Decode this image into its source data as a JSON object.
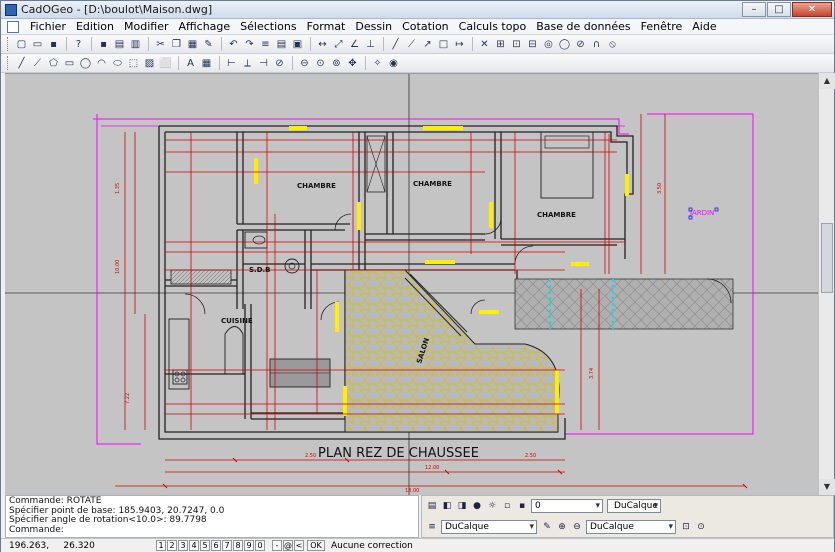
{
  "window": {
    "title": "CadOGeo - [D:\\boulot\\Maison.dwg]",
    "controls": {
      "minimize": "–",
      "maximize": "□",
      "close": "✕"
    }
  },
  "menu": {
    "items": [
      "Fichier",
      "Edition",
      "Modifier",
      "Affichage",
      "Sélections",
      "Format",
      "Dessin",
      "Cotation",
      "Calculs topo",
      "Base de données",
      "Fenêtre",
      "Aide"
    ]
  },
  "drawing": {
    "title": "PLAN REZ DE CHAUSSEE",
    "rooms": {
      "chambre1": "CHAMBRE",
      "chambre2": "CHAMBRE",
      "chambre3": "CHAMBRE",
      "sdb": "S.D.B",
      "cuisine": "CUISINE",
      "salon": "SALON",
      "jardin": "JARDIN"
    },
    "colors": {
      "background": "#c4c4c4",
      "walls": "#222222",
      "dimensions": "#d40000",
      "hatch": "#e6d000",
      "outline": "#ff00ff",
      "terrace": "#aaaaaa",
      "floor_fill": "#b7b7b7"
    }
  },
  "command_history": [
    "Commande:  ROTATE",
    "  Spécifier point de base:  185.9403, 20.7247, 0.0",
    "  Spécifier angle de rotation<10.0>:  89.7798",
    "Commande: "
  ],
  "properties": {
    "layer_value": "0",
    "color_value": "DuCalque",
    "linetype_value": "DuCalque",
    "lineweight_value": "DuCalque"
  },
  "status": {
    "coords_x": "196.263,",
    "coords_y": "26.320",
    "snap_digits": [
      "1",
      "2",
      "3",
      "4",
      "5",
      "6",
      "7",
      "8",
      "9",
      "0"
    ],
    "snap_extra": [
      "-",
      "@",
      "<"
    ],
    "ok_label": "OK",
    "correction_text": "Aucune correction"
  }
}
